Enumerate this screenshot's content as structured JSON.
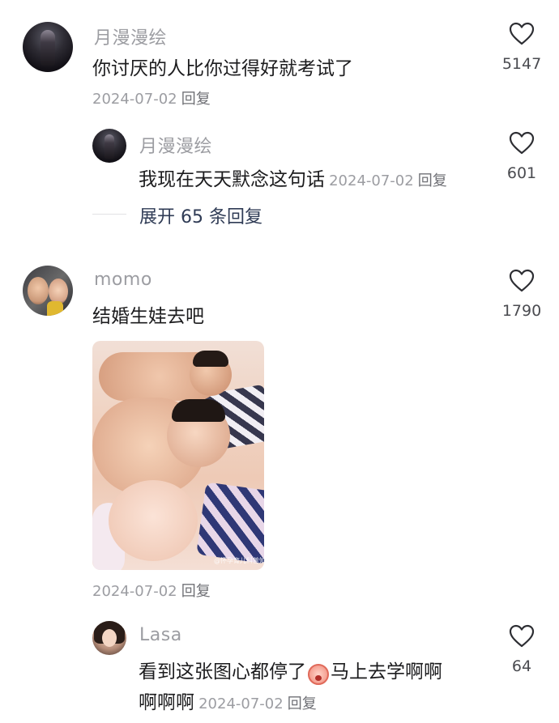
{
  "comments": [
    {
      "author": "月漫漫绘",
      "text": "你讨厌的人比你过得好就考试了",
      "date": "2024-07-02",
      "reply_label": "回复",
      "likes": "5147",
      "replies": [
        {
          "author": "月漫漫绘",
          "text": "我现在天天默念这句话",
          "date": "2024-07-02",
          "reply_label": "回复",
          "likes": "601"
        }
      ],
      "expand_label": "展开 65 条回复"
    },
    {
      "author": "momo",
      "text": "结婚生娃去吧",
      "image_watermark": "@怀孕育儿科普知识",
      "date": "2024-07-02",
      "reply_label": "回复",
      "likes": "1790",
      "replies": [
        {
          "author": "Lasa",
          "text_before": "看到这张图心都停了",
          "emoji": "crying-face-emoji",
          "text_after_line1": "马上去学啊啊",
          "text_line2": "啊啊啊",
          "date": "2024-07-02",
          "reply_label": "回复",
          "likes": "64"
        }
      ]
    }
  ],
  "icons": {
    "like": "heart-outline-icon"
  },
  "colors": {
    "text": "#1c1c1e",
    "meta": "#9c9da2",
    "expand": "#2f3b55"
  }
}
